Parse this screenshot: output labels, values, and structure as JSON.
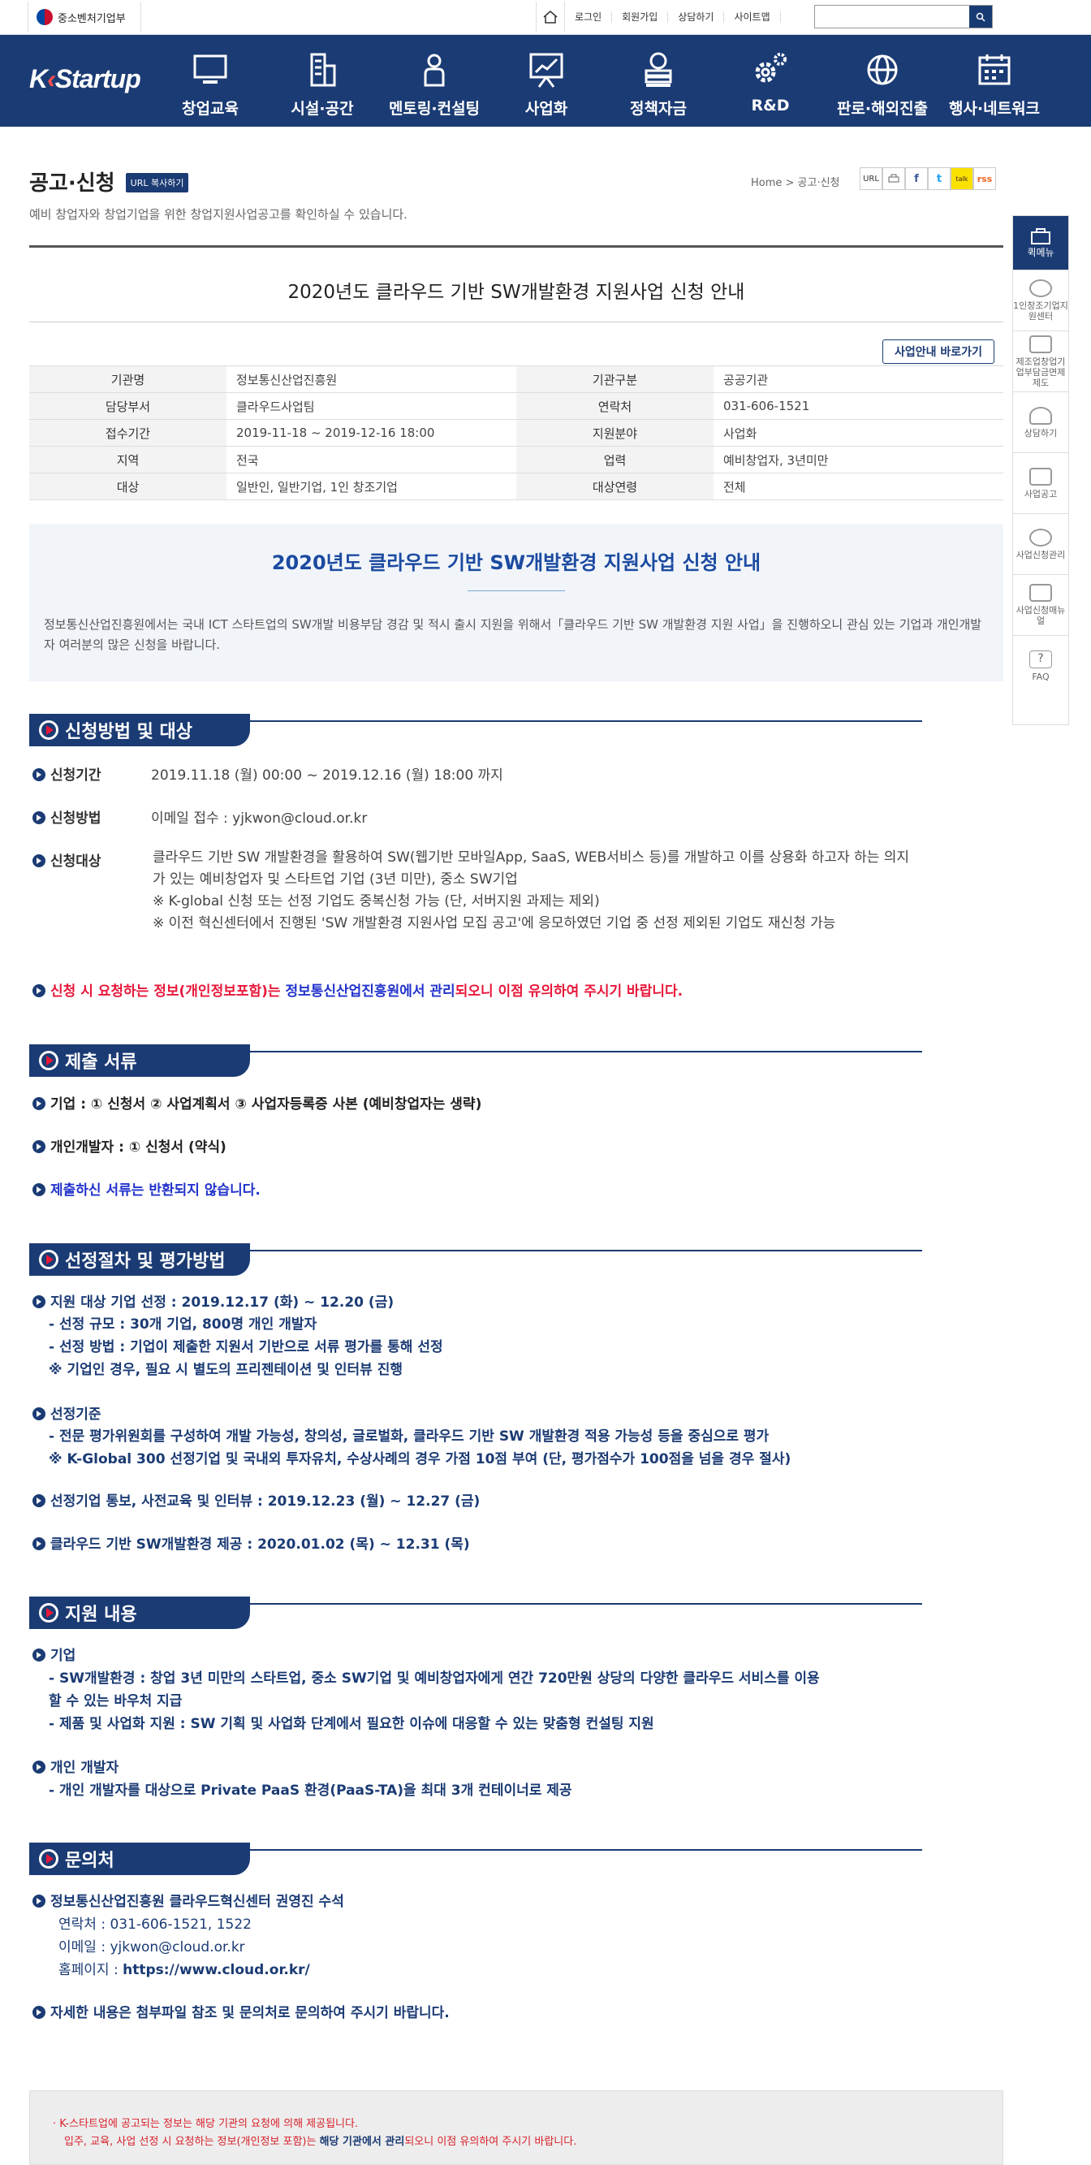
{
  "topbar": {
    "gov_name": "중소벤처기업부",
    "links": [
      "로그인",
      "회원가입",
      "상담하기",
      "사이트맵"
    ],
    "search_placeholder": ""
  },
  "brand": {
    "logo": "K-Startup"
  },
  "gnb": [
    "창업교육",
    "시설·공간",
    "멘토링·컨설팅",
    "사업화",
    "정책자금",
    "R&D",
    "판로·해외진출",
    "행사·네트워크"
  ],
  "page": {
    "title": "공고·신청",
    "url_copy": "URL 복사하기",
    "description": "예비 창업자와 창업기업을 위한 창업지원사업공고를 확인하실 수 있습니다.",
    "breadcrumb": "Home > 공고·신청",
    "share": [
      "URL",
      "print",
      "f",
      "t",
      "talk",
      "rss"
    ]
  },
  "notice": {
    "title": "2020년도 클라우드 기반 SW개발환경 지원사업 신청 안내",
    "shortcut": "사업안내 바로가기"
  },
  "info": [
    [
      "기관명",
      "정보통신산업진흥원",
      "기관구분",
      "공공기관"
    ],
    [
      "담당부서",
      "클라우드사업팀",
      "연락처",
      "031-606-1521"
    ],
    [
      "접수기간",
      "2019-11-18 ~ 2019-12-16 18:00",
      "지원분야",
      "사업화"
    ],
    [
      "지역",
      "전국",
      "업력",
      "예비창업자, 3년미만"
    ],
    [
      "대상",
      "일반인, 일반기업, 1인 창조기업",
      "대상연령",
      "전체"
    ]
  ],
  "intro": {
    "title": "2020년도 클라우드 기반 SW개발환경 지원사업 신청 안내",
    "body": "정보통신산업진흥원에서는 국내 ICT 스타트업의 SW개발 비용부담 경감 및 적시 출시 지원을 위해서「클라우드 기반 SW 개발환경 지원 사업」을 진행하오니 관심 있는 기업과 개인개발자 여러분의 많은 신청을 바랍니다."
  },
  "sections": {
    "s1": "신청방법 및 대상",
    "s2": "제출 서류",
    "s3": "선정절차 및 평가방법",
    "s4": "지원 내용",
    "s5": "문의처"
  },
  "apply": {
    "period_label": "신청기간",
    "period": "2019.11.18 (월) 00:00 ~ 2019.12.16 (월) 18:00 까지",
    "method_label": "신청방법",
    "method": "이메일 접수 : yjkwon@cloud.or.kr",
    "target_label": "신청대상",
    "target_lines": [
      "클라우드 기반 SW 개발환경을 활용하여 SW(웹기반 모바일App, SaaS, WEB서비스 등)를 개발하고 이를 상용화 하고자 하는 의지가 있는 예비창업자 및 스타트업 기업 (3년 미만), 중소 SW기업",
      "※ K-global 신청 또는 선정 기업도 중복신청 가능 (단, 서버지원 과제는 제외)",
      "※ 이전 혁신센터에서 진행된 'SW 개발환경 지원사업 모집 공고'에 응모하였던 기업 중 선정 제외된 기업도 재신청 가능"
    ],
    "warn_a": "신청 시 요청하는 정보(개인정보포함)는 ",
    "warn_b": "정보통신산업진흥원에서 관리",
    "warn_c": "되오니 이점 유의하여 주시기 바랍니다."
  },
  "docs": [
    "기업 : ① 신청서 ② 사업계획서 ③ 사업자등록증 사본 (예비창업자는 생략)",
    "개인개발자 : ① 신청서 (약식)",
    "제출하신 서류는 반환되지 않습니다."
  ],
  "select": {
    "l1": "지원 대상 기업 선정 : 2019.12.17 (화) ~ 12.20 (금)",
    "l1a": "- 선정 규모 : 30개 기업, 800명 개인 개발자",
    "l1b": "- 선정 방법 : 기업이 제출한 지원서 기반으로 서류 평가를 통해 선정",
    "l1c": "※ 기업인 경우, 필요 시 별도의 프리젠테이션 및 인터뷰 진행",
    "l2": "선정기준",
    "l2a": "- 전문 평가위원회를 구성하여 개발 가능성, 창의성, 글로벌화, 클라우드 기반 SW 개발환경 적용 가능성 등을 중심으로 평가",
    "l2b": "※ K-Global 300 선정기업 및 국내외 투자유치, 수상사례의 경우 가점 10점 부여 (단, 평가점수가 100점을 넘을 경우 절사)",
    "l3": "선정기업 통보, 사전교육 및 인터뷰 : 2019.12.23 (월) ~ 12.27 (금)",
    "l4": "클라우드 기반 SW개발환경 제공 : 2020.01.02 (목) ~ 12.31 (목)"
  },
  "support": {
    "l1": "기업",
    "l1a": "- SW개발환경 : 창업 3년 미만의 스타트업, 중소 SW기업 및 예비창업자에게 연간 720만원 상당의 다양한 클라우드 서비스를 이용",
    "l1a2": "할 수 있는 바우처 지급",
    "l1b": "- 제품 및 사업화 지원 : SW 기획 및 사업화 단계에서 필요한 이슈에 대응할 수 있는 맞춤형 컨설팅 지원",
    "l2": "개인 개발자",
    "l2a": "- 개인 개발자를 대상으로 Private PaaS 환경(PaaS-TA)을 최대 3개 컨테이너로 제공"
  },
  "contact": {
    "l1": "정보통신산업진흥원 클라우드혁신센터 권영진 수석",
    "tel": "연락처 : 031-606-1521, 1522",
    "mail": "이메일 : yjkwon@cloud.or.kr",
    "home_label": "홈페이지 : ",
    "home": "https://www.cloud.or.kr/",
    "final": "자세한 내용은 첨부파일 참조 및 문의처로 문의하여 주시기 바랍니다."
  },
  "footer_notice": {
    "l1": "K-스타트업에 공고되는 정보는 해당 기관의 요청에 의해 제공됩니다.",
    "l2a": "입주, 교육, 사업 선정 시 요청하는 정보(개인정보 포함)는 ",
    "l2b": "해당 기관에서 관리",
    "l2c": "되오니 이점 유의하여 주시기 바랍니다."
  },
  "quick": [
    "퀵메뉴",
    "1인창조기업지원센터",
    "제조업창업기업부담금면제제도",
    "상담하기",
    "사업공고",
    "사업신청관리",
    "사업신청매뉴얼",
    "FAQ"
  ]
}
